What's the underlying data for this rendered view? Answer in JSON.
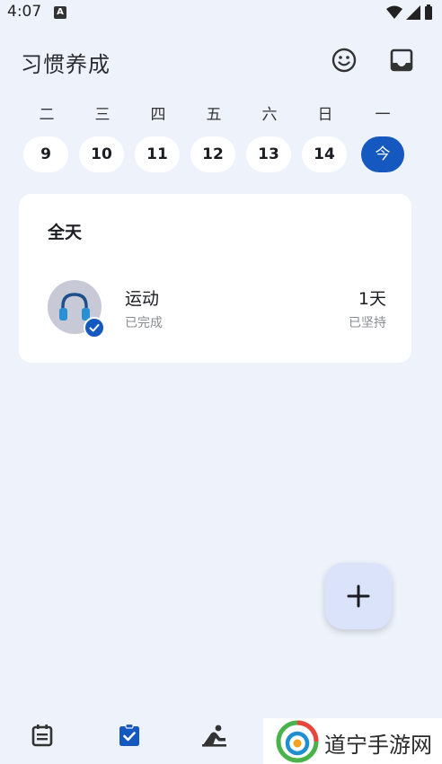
{
  "status_bar": {
    "time": "4:07",
    "badge": "A"
  },
  "header": {
    "title": "习惯养成",
    "smile_icon": "smile-icon",
    "inbox_icon": "inbox-icon"
  },
  "week": {
    "days": [
      {
        "name": "二",
        "date": "9",
        "today": false
      },
      {
        "name": "三",
        "date": "10",
        "today": false
      },
      {
        "name": "四",
        "date": "11",
        "today": false
      },
      {
        "name": "五",
        "date": "12",
        "today": false
      },
      {
        "name": "六",
        "date": "13",
        "today": false
      },
      {
        "name": "日",
        "date": "14",
        "today": false
      },
      {
        "name": "一",
        "date": "今",
        "today": true
      }
    ]
  },
  "card": {
    "title": "全天",
    "habit": {
      "name": "运动",
      "status": "已完成",
      "days": "1天",
      "days_label": "已坚持",
      "icon": "headphones-icon"
    }
  },
  "fab": {
    "label": "+"
  },
  "bottom_nav": {
    "items": [
      "calendar-icon",
      "clipboard-check-icon",
      "meditation-icon"
    ]
  },
  "watermark": {
    "text": "道宁手游网"
  },
  "colors": {
    "accent": "#1558c0",
    "background": "#eef3fb",
    "fab": "#dbe3fa"
  }
}
